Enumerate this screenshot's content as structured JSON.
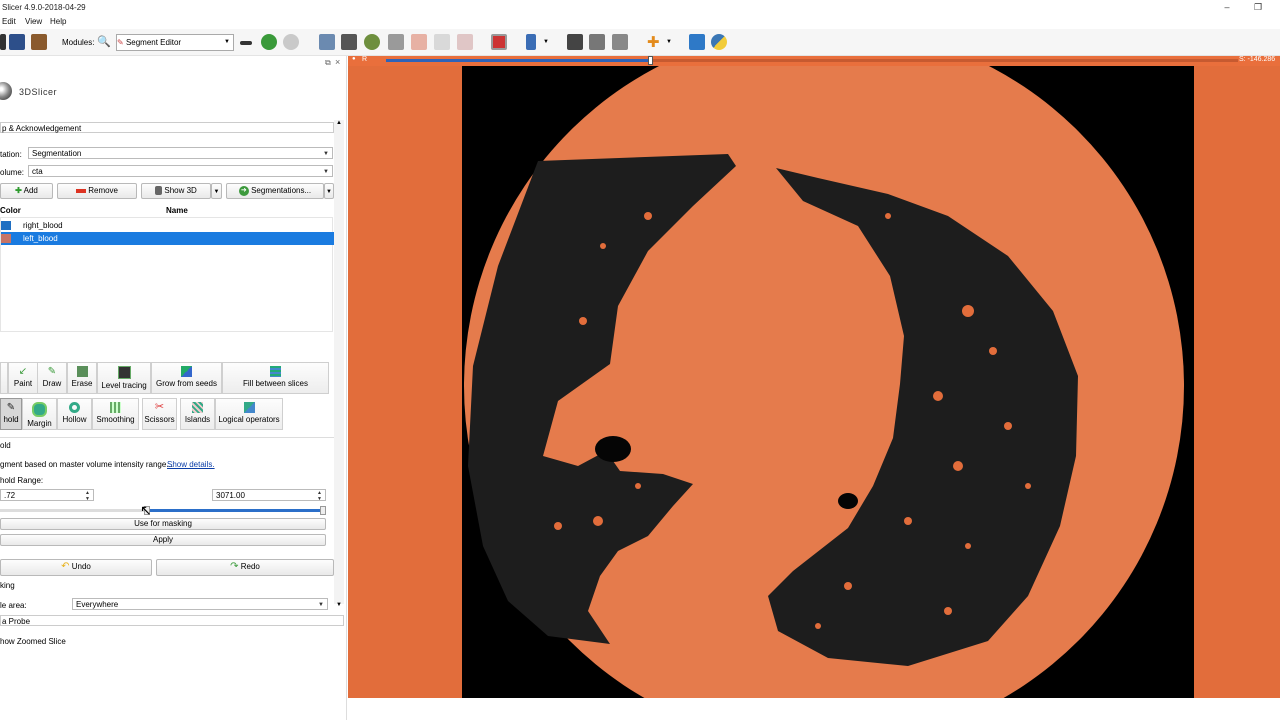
{
  "window": {
    "title": "Slicer 4.9.0-2018-04-29",
    "minimize_glyph": "–",
    "restore_glyph": "❐"
  },
  "menu": {
    "items": [
      "Edit",
      "View",
      "Help"
    ]
  },
  "toolbar": {
    "modules_label": "Modules:",
    "module_selected": "Segment Editor"
  },
  "panel": {
    "logo_text": "3DSlicer",
    "help_section": "p & Acknowledgement",
    "segmentation_label": "tation:",
    "segmentation_value": "Segmentation",
    "master_volume_label": "olume:",
    "master_volume_value": "cta",
    "add_label": "Add",
    "remove_label": "Remove",
    "show3d_label": "Show 3D",
    "segmentations_label": "Segmentations...",
    "table_headers": {
      "color": "Color",
      "name": "Name"
    },
    "segments": [
      {
        "name": "right_blood",
        "color": "#1f6fc2",
        "selected": false
      },
      {
        "name": "left_blood",
        "color": "#c77466",
        "selected": true
      }
    ],
    "effects_row1": [
      "",
      "Paint",
      "Draw",
      "Erase",
      "Level tracing",
      "Grow from seeds",
      "Fill between slices"
    ],
    "effects_row2": [
      "hold",
      "Margin",
      "Hollow",
      "Smoothing",
      "Scissors",
      "Islands",
      "Logical operators"
    ],
    "effect_name": "old",
    "effect_description": "gment based on master volume intensity range...",
    "show_details": "Show details.",
    "threshold_label": "hold Range:",
    "threshold_min": ".72",
    "threshold_max": "3071.00",
    "threshold_low_fraction": 0.45,
    "use_masking_label": "Use for masking",
    "apply_label": "Apply",
    "undo_label": "Undo",
    "redo_label": "Redo",
    "masking_section": "king",
    "editable_area_label": "le area:",
    "editable_area_value": "Everywhere",
    "data_probe": "a Probe",
    "zoomed_slice": "how Zoomed Slice"
  },
  "viewer": {
    "orientation_label": "R",
    "slice_offset": "S: -146.286",
    "slider_fraction": 0.31,
    "overlay_color": "#e26d3b",
    "lung_color": "#1d1d1d"
  },
  "colors": {
    "selection": "#1a7be0",
    "slice_bar": "#2f63b8"
  }
}
